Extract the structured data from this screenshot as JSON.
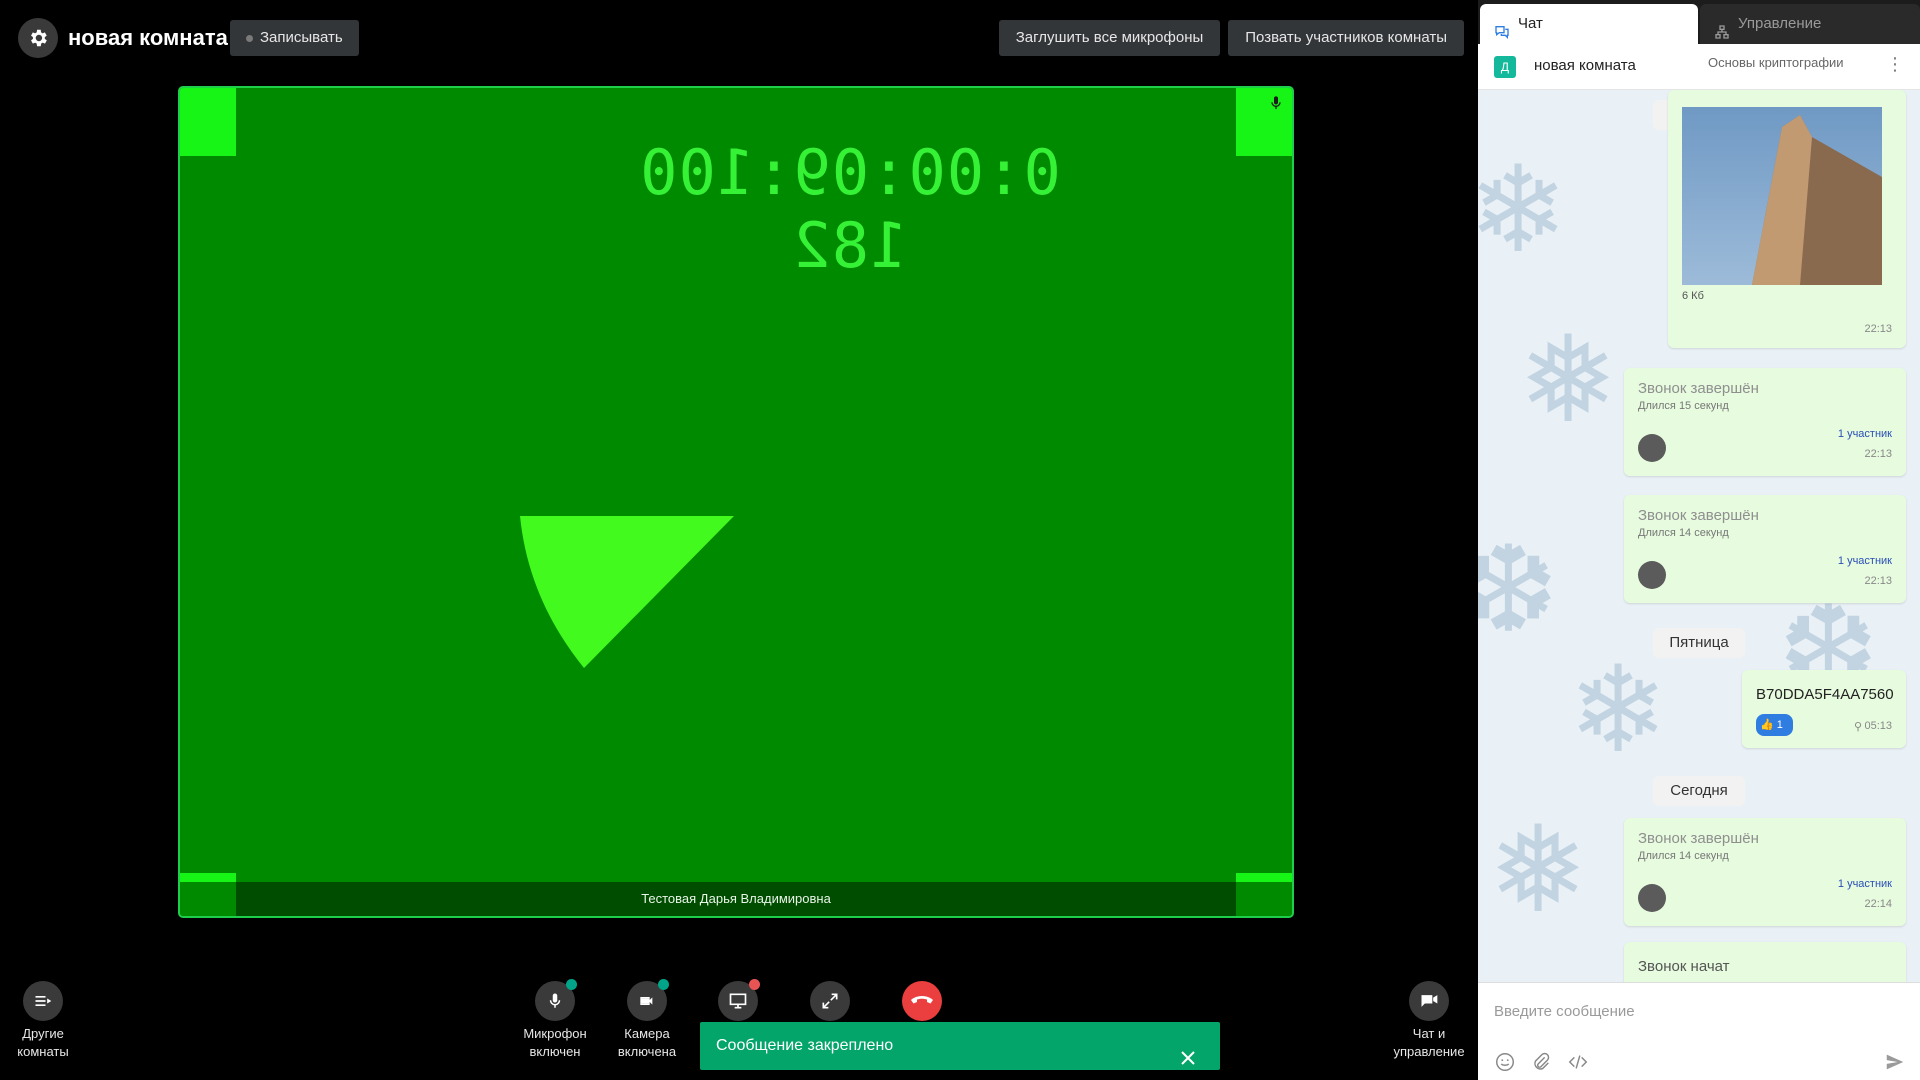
{
  "header": {
    "room_title": "новая комната",
    "record_label": "Записывать",
    "mute_all_label": "Заглушить все микрофоны",
    "invite_label": "Позвать участников комнаты"
  },
  "video": {
    "timecode": "0:00:09:100 182",
    "participant_name": "Тестовая Дарья Владимировна"
  },
  "controls": {
    "other_rooms": "Другие комнаты",
    "mic": "Микрофон включен",
    "camera": "Камера включена",
    "chat_manage": "Чат и управление"
  },
  "toast": {
    "text": "Сообщение закреплено"
  },
  "panel": {
    "tab_chat": "Чат",
    "tab_manage": "Управление",
    "room_initial": "Д",
    "room_name": "новая комната",
    "room_subtitle": "Основы криптографии",
    "composer_placeholder": "Введите сообщение"
  },
  "messages": {
    "day_today": "Сегодня",
    "image_size": "6 Кб",
    "image_time": "22:13",
    "call1": {
      "title": "Звонок завершён",
      "duration": "Длился 15 секунд",
      "participants": "1 участник",
      "time": "22:13"
    },
    "call2": {
      "title": "Звонок завершён",
      "duration": "Длился 14 секунд",
      "participants": "1 участник",
      "time": "22:13"
    },
    "day_friday": "Пятница",
    "hex_text": "B70DDA5F4AA7560",
    "reaction_count": "1",
    "hex_time": "05:13",
    "day_today2": "Сегодня",
    "call3": {
      "title": "Звонок завершён",
      "duration": "Длился 14 секунд",
      "participants": "1 участник",
      "time": "22:14"
    },
    "call4_title": "Звонок начат"
  },
  "colors": {
    "video_bg": "#008a00",
    "video_border": "#1fcf4c",
    "toast_bg": "#04a56a",
    "end_call": "#eb3f3f",
    "status_badge": "#01a488"
  }
}
